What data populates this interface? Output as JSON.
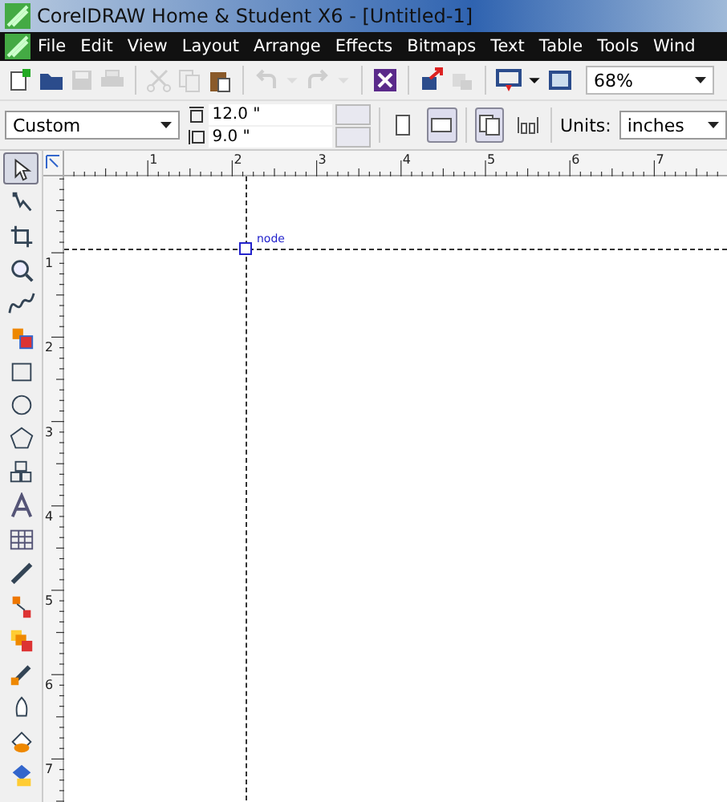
{
  "window": {
    "title": "CorelDRAW Home & Student X6 - [Untitled-1]"
  },
  "menu": [
    "File",
    "Edit",
    "View",
    "Layout",
    "Arrange",
    "Effects",
    "Bitmaps",
    "Text",
    "Table",
    "Tools",
    "Wind"
  ],
  "toolbar": [
    {
      "kind": "new",
      "disabled": false
    },
    {
      "kind": "open",
      "disabled": false
    },
    {
      "kind": "save",
      "disabled": true
    },
    {
      "kind": "print",
      "disabled": true
    },
    {
      "kind": "sep"
    },
    {
      "kind": "cut",
      "disabled": true
    },
    {
      "kind": "copy",
      "disabled": true
    },
    {
      "kind": "paste",
      "disabled": false
    },
    {
      "kind": "sep"
    },
    {
      "kind": "undo",
      "disabled": true
    },
    {
      "kind": "caret",
      "disabled": true
    },
    {
      "kind": "redo",
      "disabled": true
    },
    {
      "kind": "caret",
      "disabled": true
    },
    {
      "kind": "sep"
    },
    {
      "kind": "launcher",
      "disabled": false
    },
    {
      "kind": "sep"
    },
    {
      "kind": "import",
      "disabled": false
    },
    {
      "kind": "export",
      "disabled": true
    },
    {
      "kind": "sep"
    },
    {
      "kind": "publish",
      "disabled": false
    },
    {
      "kind": "caret",
      "disabled": false
    },
    {
      "kind": "fullscreen",
      "disabled": false
    }
  ],
  "zoom": {
    "value": "68%"
  },
  "property_bar": {
    "page_size": "Custom",
    "width": "12.0 \"",
    "height": "9.0 \"",
    "orientations": [
      {
        "kind": "portrait",
        "selected": false
      },
      {
        "kind": "landscape",
        "selected": true
      }
    ],
    "page_buttons": [
      {
        "kind": "all-pages",
        "selected": true
      },
      {
        "kind": "current-page",
        "selected": false
      }
    ],
    "units_label": "Units:",
    "units": "inches"
  },
  "ruler": {
    "h_labels": [
      "1",
      "2",
      "3",
      "4",
      "5",
      "6",
      "7"
    ],
    "v_labels": [
      "1",
      "2",
      "3",
      "4",
      "5",
      "6",
      "7"
    ]
  },
  "tools": [
    {
      "kind": "pick",
      "selected": true
    },
    {
      "kind": "shape",
      "selected": false
    },
    {
      "kind": "crop",
      "selected": false
    },
    {
      "kind": "zoom",
      "selected": false
    },
    {
      "kind": "freehand",
      "selected": false
    },
    {
      "kind": "smartfill",
      "selected": false
    },
    {
      "kind": "rectangle",
      "selected": false
    },
    {
      "kind": "ellipse",
      "selected": false
    },
    {
      "kind": "polygon",
      "selected": false
    },
    {
      "kind": "shapes",
      "selected": false
    },
    {
      "kind": "text",
      "selected": false
    },
    {
      "kind": "table",
      "selected": false
    },
    {
      "kind": "dimension",
      "selected": false
    },
    {
      "kind": "connector",
      "selected": false
    },
    {
      "kind": "blend",
      "selected": false
    },
    {
      "kind": "eyedropper",
      "selected": false
    },
    {
      "kind": "outline",
      "selected": false
    },
    {
      "kind": "fill",
      "selected": false
    },
    {
      "kind": "interactive",
      "selected": false
    }
  ],
  "canvas": {
    "node_label": "node"
  }
}
